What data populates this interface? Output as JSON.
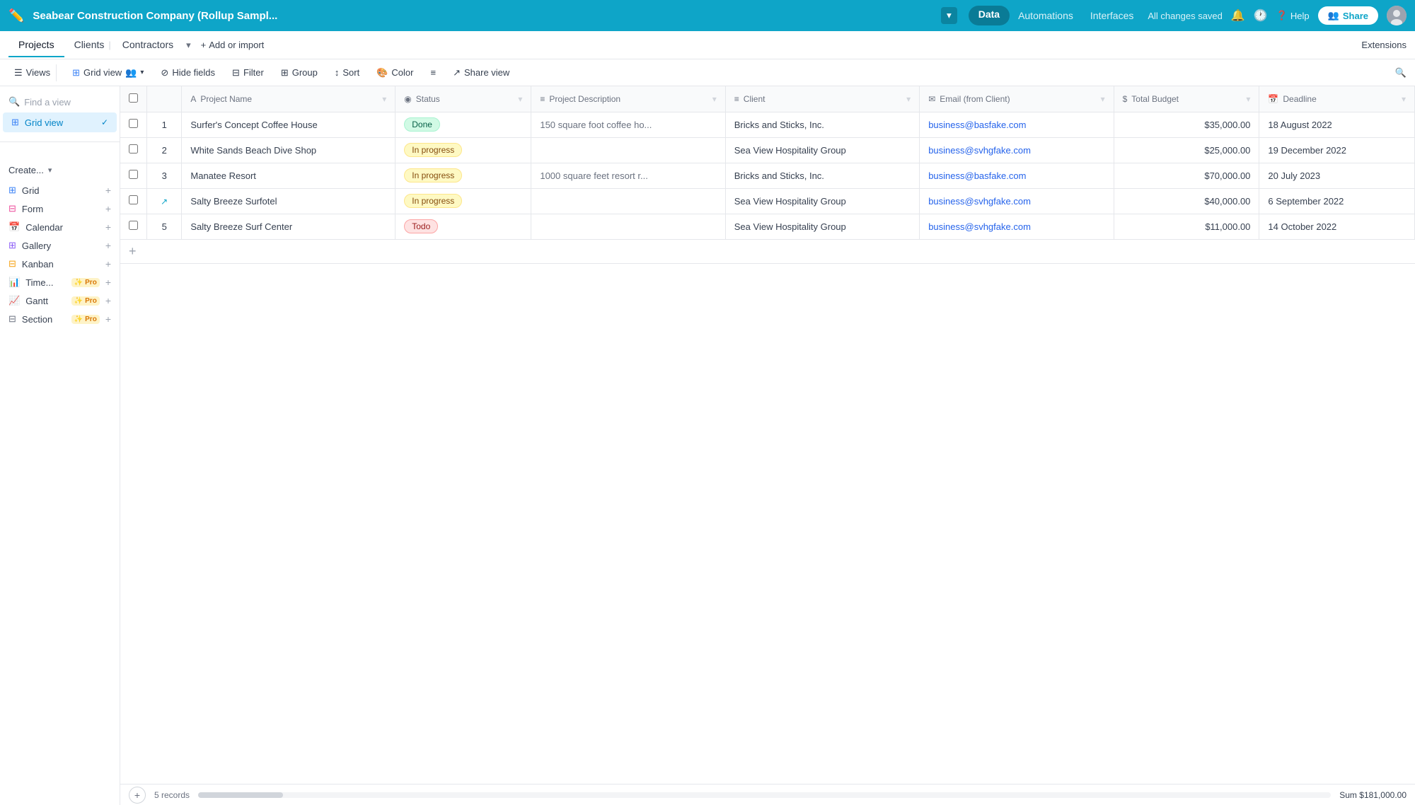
{
  "app": {
    "title": "Seabear Construction Company (Rollup Sampl...",
    "status": "All changes saved"
  },
  "topnav": {
    "logo_icon": "✏️",
    "title": "Seabear Construction Company (Rollup Sampl...",
    "tabs": [
      "Data",
      "Automations",
      "Interfaces"
    ],
    "active_tab": "Data",
    "saved": "All changes saved",
    "help": "Help",
    "share": "Share"
  },
  "secondnav": {
    "tabs": [
      "Projects",
      "Clients",
      "Contractors"
    ],
    "active_tab": "Projects",
    "add_label": "Add or import",
    "extensions": "Extensions"
  },
  "toolbar": {
    "views": "Views",
    "grid_view": "Grid view",
    "hide_fields": "Hide fields",
    "filter": "Filter",
    "group": "Group",
    "sort": "Sort",
    "color": "Color",
    "share_view": "Share view"
  },
  "sidebar": {
    "search_placeholder": "Find a view",
    "views": [
      {
        "label": "Grid view",
        "active": true
      }
    ],
    "create_label": "Create...",
    "view_types": [
      {
        "label": "Grid",
        "icon": "grid",
        "pro": false
      },
      {
        "label": "Form",
        "icon": "form",
        "pro": false
      },
      {
        "label": "Calendar",
        "icon": "calendar",
        "pro": false
      },
      {
        "label": "Gallery",
        "icon": "gallery",
        "pro": false
      },
      {
        "label": "Kanban",
        "icon": "kanban",
        "pro": false
      },
      {
        "label": "Time...",
        "icon": "timeline",
        "pro": true
      },
      {
        "label": "Gantt",
        "icon": "gantt",
        "pro": true
      },
      {
        "label": "Section",
        "icon": "section",
        "pro": true
      }
    ]
  },
  "table": {
    "columns": [
      {
        "label": "Project Name",
        "icon": "A"
      },
      {
        "label": "Status",
        "icon": "◉"
      },
      {
        "label": "Project Description",
        "icon": "≡"
      },
      {
        "label": "Client",
        "icon": "≡"
      },
      {
        "label": "Email (from Client)",
        "icon": "✉"
      },
      {
        "label": "Total Budget",
        "icon": "$"
      },
      {
        "label": "Deadline",
        "icon": "📅"
      }
    ],
    "rows": [
      {
        "num": "1",
        "project_name": "Surfer's Concept Coffee House",
        "status": "Done",
        "status_type": "done",
        "description": "150 square foot coffee ho...",
        "client": "Bricks and Sticks, Inc.",
        "email": "business@basfake.com",
        "budget": "$35,000.00",
        "deadline": "18 August 2022"
      },
      {
        "num": "2",
        "project_name": "White Sands Beach Dive Shop",
        "status": "In progress",
        "status_type": "inprogress",
        "description": "",
        "client": "Sea View Hospitality Group",
        "email": "business@svhgfake.com",
        "budget": "$25,000.00",
        "deadline": "19 December 2022"
      },
      {
        "num": "3",
        "project_name": "Manatee Resort",
        "status": "In progress",
        "status_type": "inprogress",
        "description": "1000 square feet resort r...",
        "client": "Bricks and Sticks, Inc.",
        "email": "business@basfake.com",
        "budget": "$70,000.00",
        "deadline": "20 July 2023"
      },
      {
        "num": "",
        "project_name": "Salty Breeze Surfotel",
        "status": "In progress",
        "status_type": "inprogress",
        "description": "",
        "client": "Sea View Hospitality Group",
        "email": "business@svhgfake.com",
        "budget": "$40,000.00",
        "deadline": "6 September 2022",
        "expand_icon": true
      },
      {
        "num": "5",
        "project_name": "Salty Breeze Surf Center",
        "status": "Todo",
        "status_type": "todo",
        "description": "",
        "client": "Sea View Hospitality Group",
        "email": "business@svhgfake.com",
        "budget": "$11,000.00",
        "deadline": "14 October 2022"
      }
    ],
    "records_count": "5 records",
    "sum_label": "Sum",
    "sum_value": "$181,000.00"
  }
}
